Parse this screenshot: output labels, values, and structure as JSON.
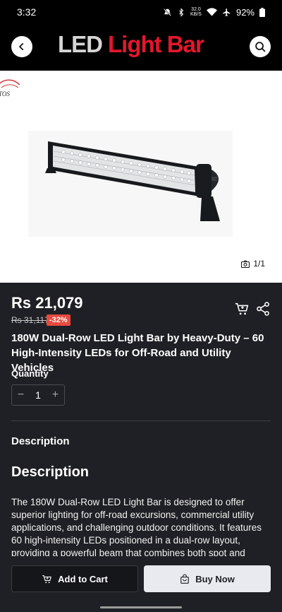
{
  "status_bar": {
    "time": "3:32",
    "speed_value": "32.0",
    "speed_unit": "KB/S",
    "battery": "92%"
  },
  "header": {
    "logo_part1": "LED",
    "logo_part2": "Light Bar",
    "back_icon": "chevron-left-icon",
    "search_icon": "search-icon"
  },
  "gallery": {
    "watermark": "TOS",
    "image_counter": "1/1",
    "camera_icon": "camera-icon"
  },
  "product": {
    "price": "Rs 21,079",
    "original_price": "Rs 31,117",
    "discount": "-32%",
    "title": "180W Dual-Row LED Light Bar by Heavy-Duty – 60 High-Intensity LEDs for Off-Road and Utility Vehicles",
    "cart_icon": "cart-icon",
    "share_icon": "share-icon"
  },
  "quantity": {
    "label": "Quantity",
    "minus": "−",
    "value": "1",
    "plus": "+"
  },
  "description": {
    "section_label": "Description",
    "heading": "Description",
    "body": "The 180W Dual-Row LED Light Bar is designed to offer superior lighting for off-road excursions, commercial utility applications, and challenging outdoor conditions. It features 60 high-intensity LEDs positioned in a dual-row layout, providing a powerful beam that combines both spot and"
  },
  "actions": {
    "add_to_cart": "Add to Cart",
    "buy_now": "Buy Now"
  },
  "colors": {
    "background": "#1f2025",
    "logo_red": "#e3172c",
    "discount_red": "#e94a3f",
    "buy_button": "#e9eaf0"
  }
}
